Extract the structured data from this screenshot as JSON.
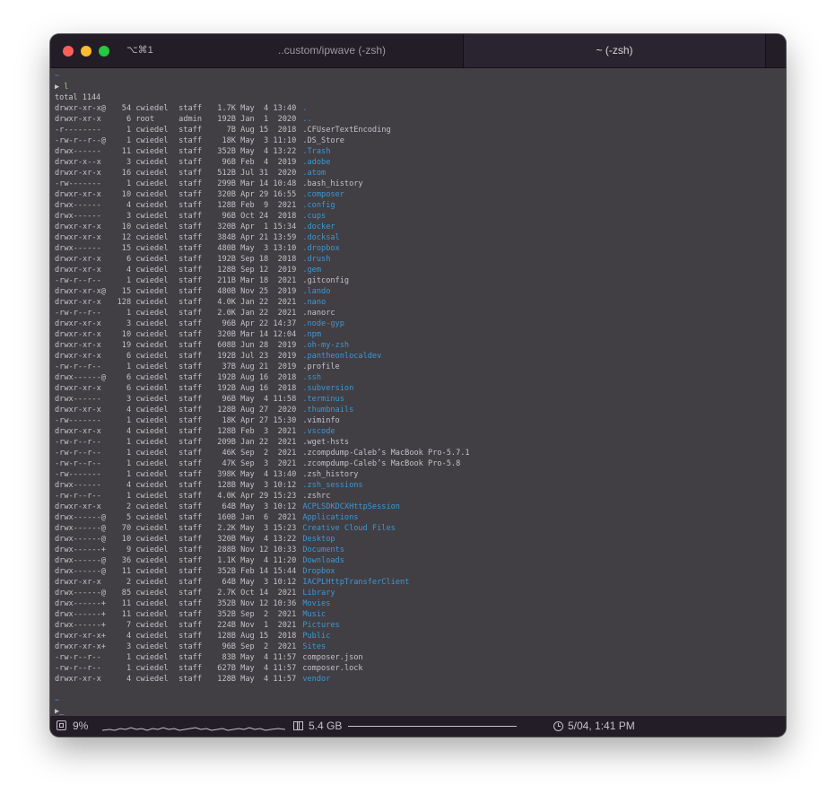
{
  "titlebar": {
    "shortcut": "⌥⌘1",
    "tabs": [
      {
        "label": "..custom/ipwave (-zsh)",
        "active": false
      },
      {
        "label": "~ (-zsh)",
        "active": true
      }
    ]
  },
  "terminal": {
    "prompt_dir": "~",
    "prompt_symbol": "▶",
    "command": "l",
    "total": "total 1144",
    "cursor": "_",
    "colors": {
      "background": "#413e44",
      "dir": "#3c99d3",
      "text": "#c5c1c8",
      "command": "#a5d36a"
    },
    "rows": [
      {
        "perm": "drwxr-xr-x@",
        "links": "54",
        "owner": "cwiedel",
        "group": "staff",
        "size": "1.7K",
        "date": "May  4 13:40",
        "name": ".",
        "dir": true
      },
      {
        "perm": "drwxr-xr-x",
        "links": "6",
        "owner": "root",
        "group": "admin",
        "size": "192B",
        "date": "Jan  1  2020",
        "name": "..",
        "dir": true
      },
      {
        "perm": "-r--------",
        "links": "1",
        "owner": "cwiedel",
        "group": "staff",
        "size": "7B",
        "date": "Aug 15  2018",
        "name": ".CFUserTextEncoding",
        "dir": false
      },
      {
        "perm": "-rw-r--r--@",
        "links": "1",
        "owner": "cwiedel",
        "group": "staff",
        "size": "18K",
        "date": "May  3 11:10",
        "name": ".DS_Store",
        "dir": false
      },
      {
        "perm": "drwx------",
        "links": "11",
        "owner": "cwiedel",
        "group": "staff",
        "size": "352B",
        "date": "May  4 13:22",
        "name": ".Trash",
        "dir": true
      },
      {
        "perm": "drwxr-x--x",
        "links": "3",
        "owner": "cwiedel",
        "group": "staff",
        "size": "96B",
        "date": "Feb  4  2019",
        "name": ".adobe",
        "dir": true
      },
      {
        "perm": "drwxr-xr-x",
        "links": "16",
        "owner": "cwiedel",
        "group": "staff",
        "size": "512B",
        "date": "Jul 31  2020",
        "name": ".atom",
        "dir": true
      },
      {
        "perm": "-rw-------",
        "links": "1",
        "owner": "cwiedel",
        "group": "staff",
        "size": "299B",
        "date": "Mar 14 10:48",
        "name": ".bash_history",
        "dir": false
      },
      {
        "perm": "drwxr-xr-x",
        "links": "10",
        "owner": "cwiedel",
        "group": "staff",
        "size": "320B",
        "date": "Apr 29 16:55",
        "name": ".composer",
        "dir": true
      },
      {
        "perm": "drwx------",
        "links": "4",
        "owner": "cwiedel",
        "group": "staff",
        "size": "128B",
        "date": "Feb  9  2021",
        "name": ".config",
        "dir": true
      },
      {
        "perm": "drwx------",
        "links": "3",
        "owner": "cwiedel",
        "group": "staff",
        "size": "96B",
        "date": "Oct 24  2018",
        "name": ".cups",
        "dir": true
      },
      {
        "perm": "drwxr-xr-x",
        "links": "10",
        "owner": "cwiedel",
        "group": "staff",
        "size": "320B",
        "date": "Apr  1 15:34",
        "name": ".docker",
        "dir": true
      },
      {
        "perm": "drwxr-xr-x",
        "links": "12",
        "owner": "cwiedel",
        "group": "staff",
        "size": "384B",
        "date": "Apr 21 13:59",
        "name": ".docksal",
        "dir": true
      },
      {
        "perm": "drwx------",
        "links": "15",
        "owner": "cwiedel",
        "group": "staff",
        "size": "480B",
        "date": "May  3 13:10",
        "name": ".dropbox",
        "dir": true
      },
      {
        "perm": "drwxr-xr-x",
        "links": "6",
        "owner": "cwiedel",
        "group": "staff",
        "size": "192B",
        "date": "Sep 18  2018",
        "name": ".drush",
        "dir": true
      },
      {
        "perm": "drwxr-xr-x",
        "links": "4",
        "owner": "cwiedel",
        "group": "staff",
        "size": "128B",
        "date": "Sep 12  2019",
        "name": ".gem",
        "dir": true
      },
      {
        "perm": "-rw-r--r--",
        "links": "1",
        "owner": "cwiedel",
        "group": "staff",
        "size": "211B",
        "date": "Mar 18  2021",
        "name": ".gitconfig",
        "dir": false
      },
      {
        "perm": "drwxr-xr-x@",
        "links": "15",
        "owner": "cwiedel",
        "group": "staff",
        "size": "480B",
        "date": "Nov 25  2019",
        "name": ".lando",
        "dir": true
      },
      {
        "perm": "drwxr-xr-x",
        "links": "128",
        "owner": "cwiedel",
        "group": "staff",
        "size": "4.0K",
        "date": "Jan 22  2021",
        "name": ".nano",
        "dir": true
      },
      {
        "perm": "-rw-r--r--",
        "links": "1",
        "owner": "cwiedel",
        "group": "staff",
        "size": "2.0K",
        "date": "Jan 22  2021",
        "name": ".nanorc",
        "dir": false
      },
      {
        "perm": "drwxr-xr-x",
        "links": "3",
        "owner": "cwiedel",
        "group": "staff",
        "size": "96B",
        "date": "Apr 22 14:37",
        "name": ".node-gyp",
        "dir": true
      },
      {
        "perm": "drwxr-xr-x",
        "links": "10",
        "owner": "cwiedel",
        "group": "staff",
        "size": "320B",
        "date": "Mar 14 12:04",
        "name": ".npm",
        "dir": true
      },
      {
        "perm": "drwxr-xr-x",
        "links": "19",
        "owner": "cwiedel",
        "group": "staff",
        "size": "608B",
        "date": "Jun 28  2019",
        "name": ".oh-my-zsh",
        "dir": true
      },
      {
        "perm": "drwxr-xr-x",
        "links": "6",
        "owner": "cwiedel",
        "group": "staff",
        "size": "192B",
        "date": "Jul 23  2019",
        "name": ".pantheonlocaldev",
        "dir": true
      },
      {
        "perm": "-rw-r--r--",
        "links": "1",
        "owner": "cwiedel",
        "group": "staff",
        "size": "37B",
        "date": "Aug 21  2019",
        "name": ".profile",
        "dir": false
      },
      {
        "perm": "drwx------@",
        "links": "6",
        "owner": "cwiedel",
        "group": "staff",
        "size": "192B",
        "date": "Aug 16  2018",
        "name": ".ssh",
        "dir": true
      },
      {
        "perm": "drwxr-xr-x",
        "links": "6",
        "owner": "cwiedel",
        "group": "staff",
        "size": "192B",
        "date": "Aug 16  2018",
        "name": ".subversion",
        "dir": true
      },
      {
        "perm": "drwx------",
        "links": "3",
        "owner": "cwiedel",
        "group": "staff",
        "size": "96B",
        "date": "May  4 11:58",
        "name": ".terminus",
        "dir": true
      },
      {
        "perm": "drwxr-xr-x",
        "links": "4",
        "owner": "cwiedel",
        "group": "staff",
        "size": "128B",
        "date": "Aug 27  2020",
        "name": ".thumbnails",
        "dir": true
      },
      {
        "perm": "-rw-------",
        "links": "1",
        "owner": "cwiedel",
        "group": "staff",
        "size": "18K",
        "date": "Apr 27 15:30",
        "name": ".viminfo",
        "dir": false
      },
      {
        "perm": "drwxr-xr-x",
        "links": "4",
        "owner": "cwiedel",
        "group": "staff",
        "size": "128B",
        "date": "Feb  3  2021",
        "name": ".vscode",
        "dir": true
      },
      {
        "perm": "-rw-r--r--",
        "links": "1",
        "owner": "cwiedel",
        "group": "staff",
        "size": "209B",
        "date": "Jan 22  2021",
        "name": ".wget-hsts",
        "dir": false
      },
      {
        "perm": "-rw-r--r--",
        "links": "1",
        "owner": "cwiedel",
        "group": "staff",
        "size": "46K",
        "date": "Sep  2  2021",
        "name": ".zcompdump-Caleb’s MacBook Pro-5.7.1",
        "dir": false
      },
      {
        "perm": "-rw-r--r--",
        "links": "1",
        "owner": "cwiedel",
        "group": "staff",
        "size": "47K",
        "date": "Sep  3  2021",
        "name": ".zcompdump-Caleb’s MacBook Pro-5.8",
        "dir": false
      },
      {
        "perm": "-rw-------",
        "links": "1",
        "owner": "cwiedel",
        "group": "staff",
        "size": "398K",
        "date": "May  4 13:40",
        "name": ".zsh_history",
        "dir": false
      },
      {
        "perm": "drwx------",
        "links": "4",
        "owner": "cwiedel",
        "group": "staff",
        "size": "128B",
        "date": "May  3 10:12",
        "name": ".zsh_sessions",
        "dir": true
      },
      {
        "perm": "-rw-r--r--",
        "links": "1",
        "owner": "cwiedel",
        "group": "staff",
        "size": "4.0K",
        "date": "Apr 29 15:23",
        "name": ".zshrc",
        "dir": false
      },
      {
        "perm": "drwxr-xr-x",
        "links": "2",
        "owner": "cwiedel",
        "group": "staff",
        "size": "64B",
        "date": "May  3 10:12",
        "name": "ACPLSDKDCXHttpSession",
        "dir": true
      },
      {
        "perm": "drwx------@",
        "links": "5",
        "owner": "cwiedel",
        "group": "staff",
        "size": "160B",
        "date": "Jan  6  2021",
        "name": "Applications",
        "dir": true
      },
      {
        "perm": "drwx------@",
        "links": "70",
        "owner": "cwiedel",
        "group": "staff",
        "size": "2.2K",
        "date": "May  3 15:23",
        "name": "Creative Cloud Files",
        "dir": true
      },
      {
        "perm": "drwx------@",
        "links": "10",
        "owner": "cwiedel",
        "group": "staff",
        "size": "320B",
        "date": "May  4 13:22",
        "name": "Desktop",
        "dir": true
      },
      {
        "perm": "drwx------+",
        "links": "9",
        "owner": "cwiedel",
        "group": "staff",
        "size": "288B",
        "date": "Nov 12 10:33",
        "name": "Documents",
        "dir": true
      },
      {
        "perm": "drwx------@",
        "links": "36",
        "owner": "cwiedel",
        "group": "staff",
        "size": "1.1K",
        "date": "May  4 11:20",
        "name": "Downloads",
        "dir": true
      },
      {
        "perm": "drwx------@",
        "links": "11",
        "owner": "cwiedel",
        "group": "staff",
        "size": "352B",
        "date": "Feb 14 15:44",
        "name": "Dropbox",
        "dir": true
      },
      {
        "perm": "drwxr-xr-x",
        "links": "2",
        "owner": "cwiedel",
        "group": "staff",
        "size": "64B",
        "date": "May  3 10:12",
        "name": "IACPLHttpTransferClient",
        "dir": true
      },
      {
        "perm": "drwx------@",
        "links": "85",
        "owner": "cwiedel",
        "group": "staff",
        "size": "2.7K",
        "date": "Oct 14  2021",
        "name": "Library",
        "dir": true
      },
      {
        "perm": "drwx------+",
        "links": "11",
        "owner": "cwiedel",
        "group": "staff",
        "size": "352B",
        "date": "Nov 12 10:36",
        "name": "Movies",
        "dir": true
      },
      {
        "perm": "drwx------+",
        "links": "11",
        "owner": "cwiedel",
        "group": "staff",
        "size": "352B",
        "date": "Sep  2  2021",
        "name": "Music",
        "dir": true
      },
      {
        "perm": "drwx------+",
        "links": "7",
        "owner": "cwiedel",
        "group": "staff",
        "size": "224B",
        "date": "Nov  1  2021",
        "name": "Pictures",
        "dir": true
      },
      {
        "perm": "drwxr-xr-x+",
        "links": "4",
        "owner": "cwiedel",
        "group": "staff",
        "size": "128B",
        "date": "Aug 15  2018",
        "name": "Public",
        "dir": true
      },
      {
        "perm": "drwxr-xr-x+",
        "links": "3",
        "owner": "cwiedel",
        "group": "staff",
        "size": "96B",
        "date": "Sep  2  2021",
        "name": "Sites",
        "dir": true
      },
      {
        "perm": "-rw-r--r--",
        "links": "1",
        "owner": "cwiedel",
        "group": "staff",
        "size": "83B",
        "date": "May  4 11:57",
        "name": "composer.json",
        "dir": false
      },
      {
        "perm": "-rw-r--r--",
        "links": "1",
        "owner": "cwiedel",
        "group": "staff",
        "size": "627B",
        "date": "May  4 11:57",
        "name": "composer.lock",
        "dir": false
      },
      {
        "perm": "drwxr-xr-x",
        "links": "4",
        "owner": "cwiedel",
        "group": "staff",
        "size": "128B",
        "date": "May  4 11:57",
        "name": "vendor",
        "dir": true
      }
    ]
  },
  "statusbar": {
    "cpu": "9%",
    "memory": "5.4 GB",
    "datetime": "5/04, 1:41 PM",
    "icons": [
      "cpu-chip-icon",
      "memory-icon",
      "clock-icon"
    ]
  }
}
